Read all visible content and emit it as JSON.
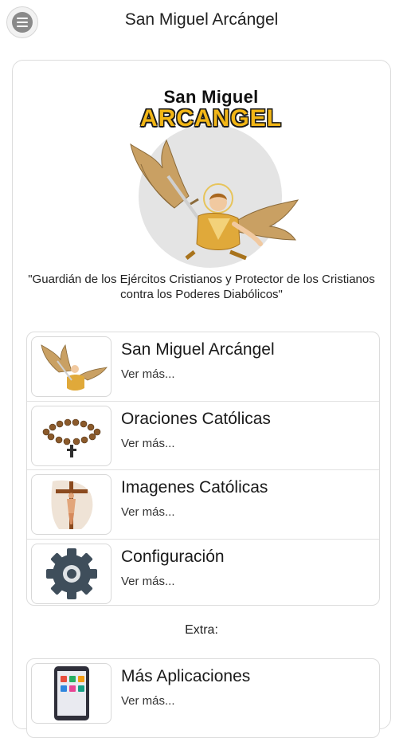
{
  "app": {
    "title": "San Miguel Arcángel",
    "menu_icon": "hamburger-menu-icon"
  },
  "hero": {
    "logo_line1": "San Miguel",
    "logo_line2": "ARCANGEL",
    "accent_color": "#f2b616"
  },
  "quote": "\"Guardián de los Ejércitos Cristianos y Protector de los Cristianos contra los Poderes Diabólicos\"",
  "menu": [
    {
      "title": "San Miguel Arcángel",
      "subtitle": "Ver más...",
      "icon": "archangel-image"
    },
    {
      "title": "Oraciones Católicas",
      "subtitle": "Ver más...",
      "icon": "rosary-image"
    },
    {
      "title": "Imagenes Católicas",
      "subtitle": "Ver más...",
      "icon": "crucifix-image"
    },
    {
      "title": "Configuración",
      "subtitle": "Ver más...",
      "icon": "gear-icon"
    }
  ],
  "extra_label": "Extra:",
  "extra_menu": [
    {
      "title": "Más Aplicaciones",
      "subtitle": "Ver más...",
      "icon": "apps-tablet-icon"
    }
  ]
}
